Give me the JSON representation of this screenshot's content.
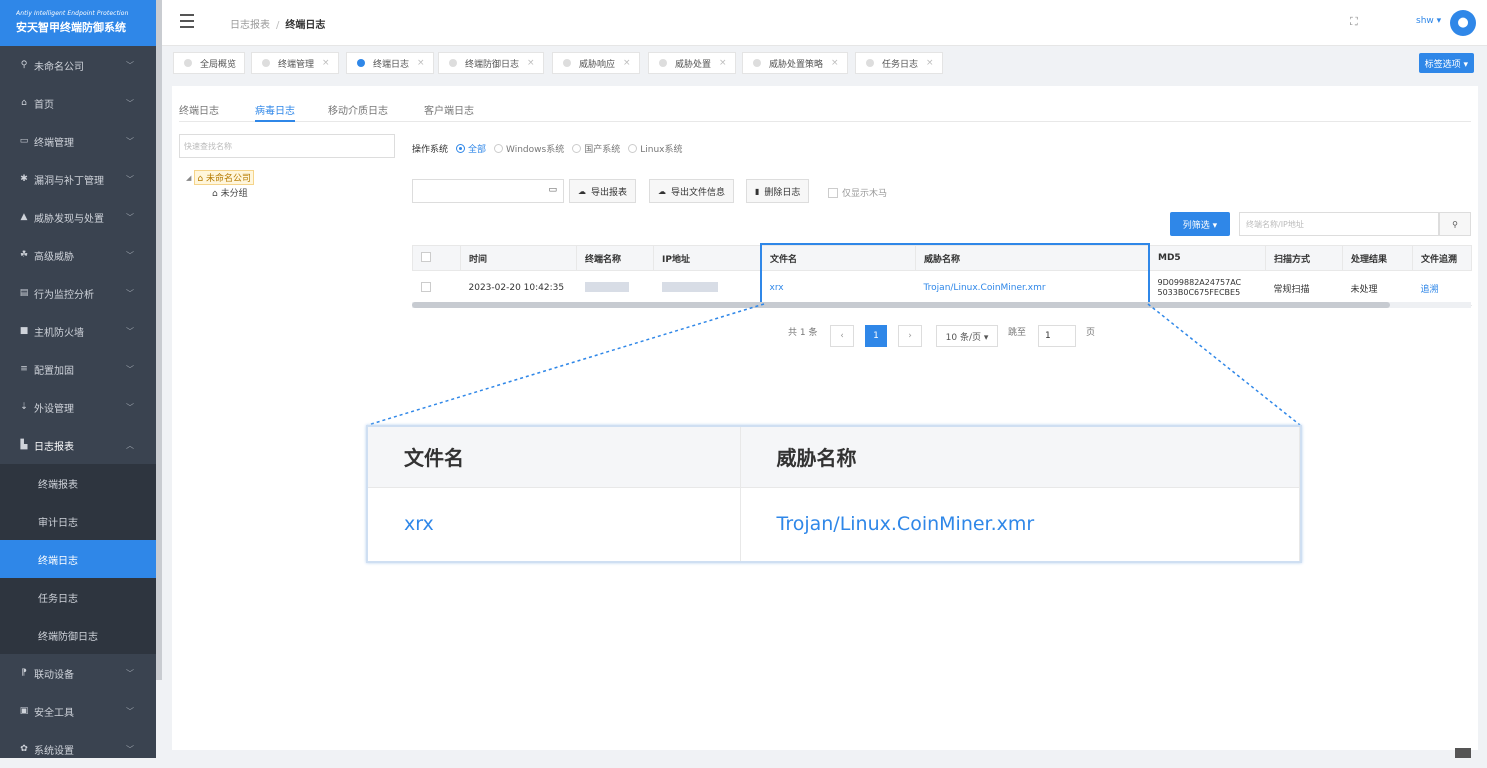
{
  "brand": {
    "en": "Antiy Intelligent Endpoint Protection",
    "cn": "安天智甲终端防御系统"
  },
  "sidebar": {
    "items": [
      {
        "icon": "map-pin-icon",
        "glyph": "⚲",
        "label": "未命名公司"
      },
      {
        "icon": "home-icon",
        "glyph": "⌂",
        "label": "首页"
      },
      {
        "icon": "monitor-icon",
        "glyph": "▭",
        "label": "终端管理"
      },
      {
        "icon": "bug-icon",
        "glyph": "✱",
        "label": "漏洞与补丁管理"
      },
      {
        "icon": "warning-icon",
        "glyph": "▲",
        "label": "威胁发现与处置"
      },
      {
        "icon": "biohazard-icon",
        "glyph": "☘",
        "label": "高级威胁"
      },
      {
        "icon": "chart-icon",
        "glyph": "▤",
        "label": "行为监控分析"
      },
      {
        "icon": "firewall-icon",
        "glyph": "■",
        "label": "主机防火墙"
      },
      {
        "icon": "settings-sliders-icon",
        "glyph": "≡",
        "label": "配置加固"
      },
      {
        "icon": "usb-icon",
        "glyph": "⇣",
        "label": "外设管理"
      },
      {
        "icon": "report-icon",
        "glyph": "▙",
        "label": "日志报表"
      }
    ],
    "subitems": [
      "终端报表",
      "审计日志",
      "终端日志",
      "任务日志",
      "终端防御日志"
    ],
    "active_sub": "终端日志",
    "bottom_items": [
      {
        "icon": "link-icon",
        "glyph": "⁋",
        "label": "联动设备"
      },
      {
        "icon": "toolbox-icon",
        "glyph": "▣",
        "label": "安全工具"
      },
      {
        "icon": "gear-icon",
        "glyph": "✿",
        "label": "系统设置"
      }
    ]
  },
  "header": {
    "breadcrumb_parent": "日志报表",
    "breadcrumb_current": "终端日志",
    "user": "shw ▾",
    "avatar": "👤"
  },
  "page_tabs": [
    "全局概览",
    "终端管理",
    "终端日志",
    "终端防御日志",
    "威胁响应",
    "威胁处置",
    "威胁处置策略",
    "任务日志"
  ],
  "active_page_tab": "终端日志",
  "tag_options": "标签选项 ▾",
  "subtabs": [
    "终端日志",
    "病毒日志",
    "移动介质日志",
    "客户端日志"
  ],
  "tree": {
    "search_placeholder": "快速查找名称",
    "root": "未命名公司",
    "child": "未分组"
  },
  "os_filter": {
    "label": "操作系统",
    "options": [
      "全部",
      "Windows系统",
      "国产系统",
      "Linux系统"
    ],
    "selected": "全部"
  },
  "actions": {
    "export_report": "导出报表",
    "export_file_info": "导出文件信息",
    "delete_log": "删除日志",
    "only_trojan": "仅显示木马"
  },
  "column_filter": "列筛选 ▾",
  "search_placeholder": "终端名称/IP地址",
  "table": {
    "headers": [
      "",
      "时间",
      "终端名称",
      "IP地址",
      "文件名",
      "威胁名称",
      "MD5",
      "扫描方式",
      "处理结果",
      "文件追溯"
    ],
    "rows": [
      {
        "time": "2023-02-20 10:42:35",
        "file": "xrx",
        "threat": "Trojan/Linux.CoinMiner.xmr",
        "md5_1": "9D099882A24757AC",
        "md5_2": "5033B0C675FECBE5",
        "scan": "常规扫描",
        "result": "未处理",
        "trace": "追溯"
      }
    ]
  },
  "pagination": {
    "total": "共 1 条",
    "current": "1",
    "page_size": "10 条/页 ▾",
    "jump_label": "跳至",
    "jump_value": "1",
    "page_unit": "页"
  },
  "zoom": {
    "header_file": "文件名",
    "header_threat": "威胁名称",
    "file": "xrx",
    "threat": "Trojan/Linux.CoinMiner.xmr"
  }
}
